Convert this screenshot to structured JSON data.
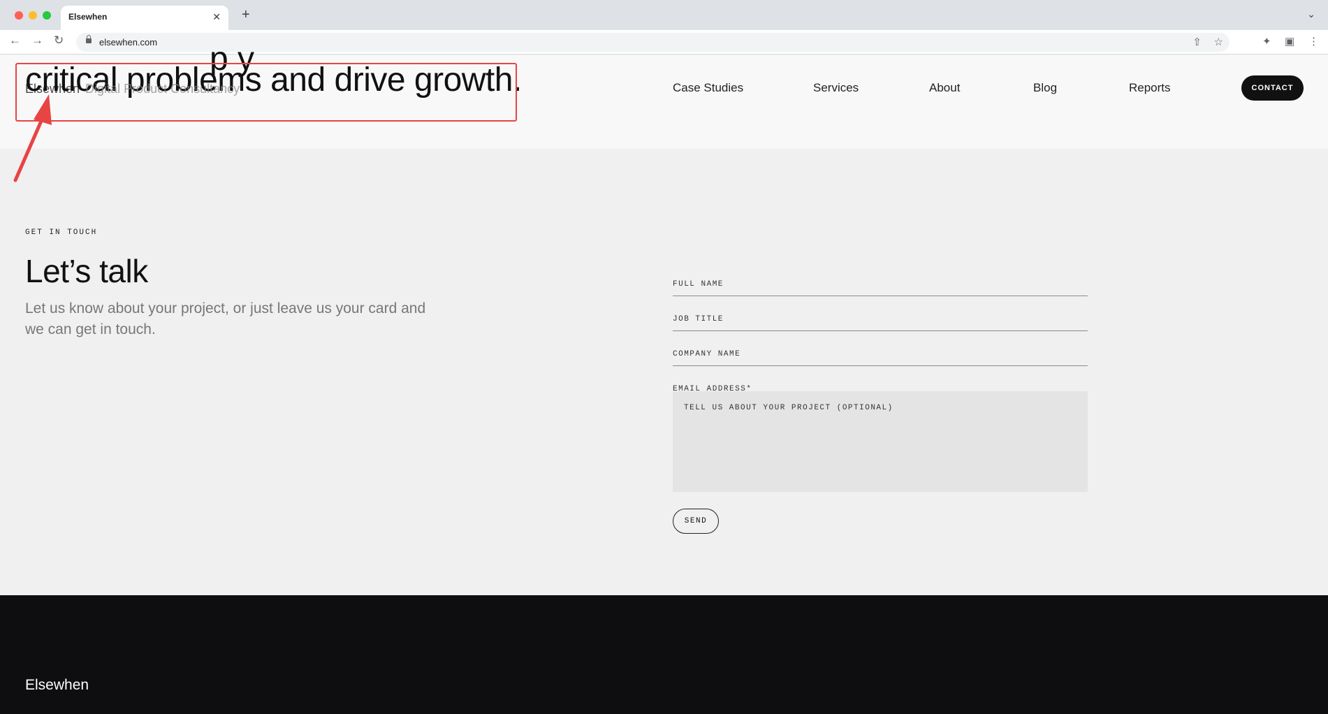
{
  "browser": {
    "tab_title": "Elsewhen",
    "tab_close": "✕",
    "new_tab": "+",
    "tab_list": "⌄",
    "url": "elsewhen.com",
    "back": "←",
    "forward": "→",
    "reload": "↻",
    "share": "⇧",
    "bookmark": "☆",
    "extensions": "✦",
    "side_panel": "▣",
    "menu": "⋮"
  },
  "header": {
    "hero_line_partial": "p y",
    "hero_line": "critical problems and drive growth.",
    "brand_name": "Elsewhen",
    "brand_tagline": "Digital Product Consultancy",
    "nav": [
      "Case Studies",
      "Services",
      "About",
      "Blog",
      "Reports"
    ],
    "contact_label": "CONTACT"
  },
  "contact": {
    "eyebrow": "GET IN TOUCH",
    "title": "Let’s talk",
    "body": "Let us know about your project, or just leave us your card and we can get in touch.",
    "fields": [
      "FULL NAME",
      "JOB TITLE",
      "COMPANY NAME",
      "EMAIL ADDRESS*"
    ],
    "textarea_placeholder": "TELL US ABOUT YOUR PROJECT (OPTIONAL)",
    "send_label": "SEND"
  },
  "footer": {
    "brand": "Elsewhen"
  },
  "colors": {
    "annotation": "#e84444",
    "footer_bg": "#0e0d0f",
    "contact_bg": "#111111"
  }
}
